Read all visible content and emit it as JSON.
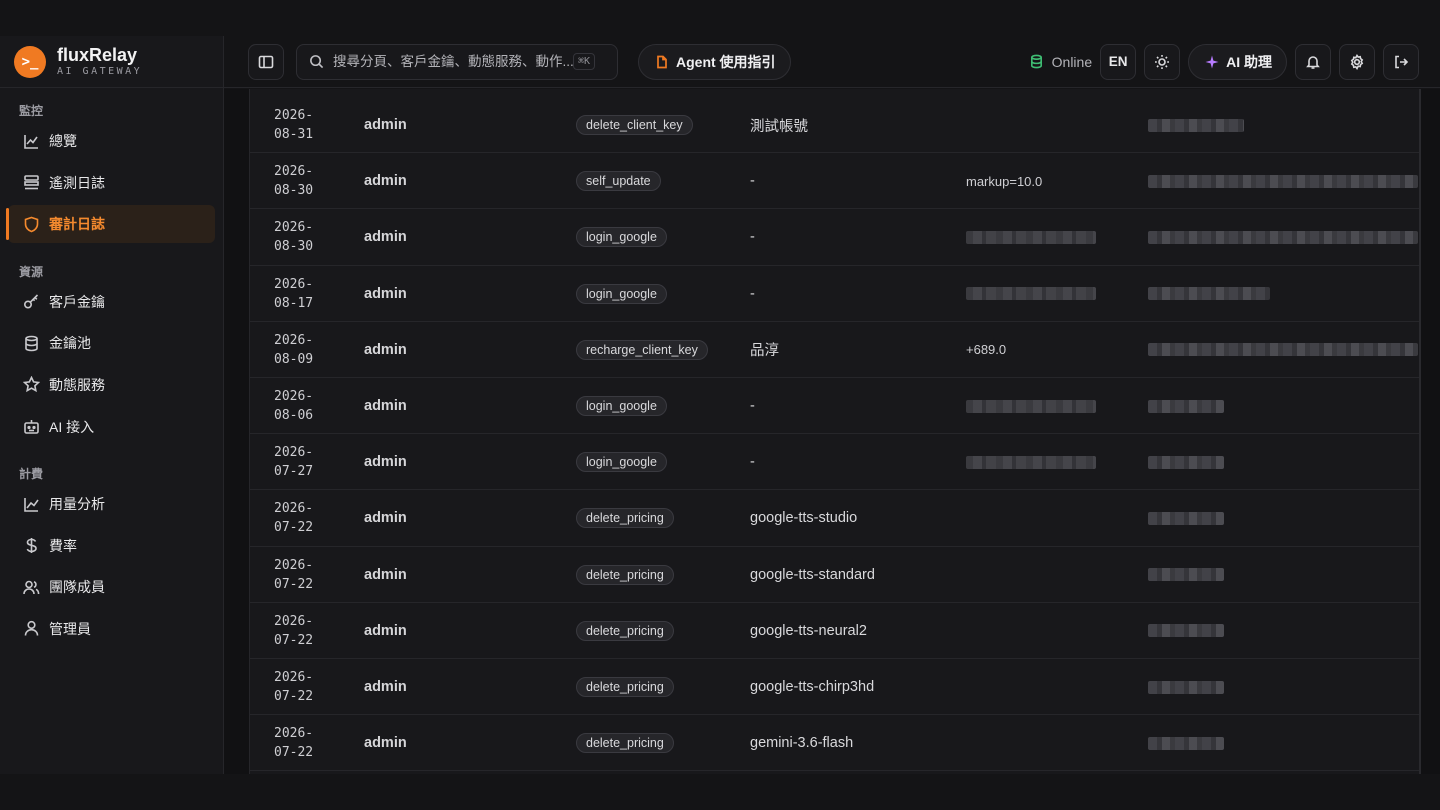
{
  "brand": {
    "name": "fluxRelay",
    "subtitle": "AI GATEWAY",
    "logo_glyph": ">_",
    "accent": "#f07a22"
  },
  "sidebar": {
    "sections": [
      {
        "label": "監控",
        "items": [
          {
            "label": "總覽",
            "icon": "line-chart-icon",
            "active": false
          },
          {
            "label": "遙測日誌",
            "icon": "log-list-icon",
            "active": false
          },
          {
            "label": "審計日誌",
            "icon": "shield-icon",
            "active": true
          }
        ]
      },
      {
        "label": "資源",
        "items": [
          {
            "label": "客戶金鑰",
            "icon": "key-icon",
            "active": false
          },
          {
            "label": "金鑰池",
            "icon": "database-icon",
            "active": false
          },
          {
            "label": "動態服務",
            "icon": "star-icon",
            "active": false
          },
          {
            "label": "AI 接入",
            "icon": "robot-icon",
            "active": false
          }
        ]
      },
      {
        "label": "計費",
        "items": [
          {
            "label": "用量分析",
            "icon": "trend-chart-icon",
            "active": false
          },
          {
            "label": "費率",
            "icon": "dollar-icon",
            "active": false
          },
          {
            "label": "團隊成員",
            "icon": "team-icon",
            "active": false
          },
          {
            "label": "管理員",
            "icon": "user-icon",
            "active": false
          }
        ]
      }
    ]
  },
  "header": {
    "search_placeholder": "搜尋分頁、客戶金鑰、動態服務、動作...",
    "search_shortcut": "⌘K",
    "agent_button": "Agent 使用指引",
    "status": "Online",
    "status_color": "#3fbf74",
    "lang": "EN",
    "ai_button": "AI 助理",
    "ai_color": "#b77cff"
  },
  "audit_rows": [
    {
      "date": "2026-\n08-31",
      "user": "admin",
      "action": "delete_client_key",
      "target": "測試帳號",
      "detail": "",
      "detail_redacted": false,
      "ip_width": 96
    },
    {
      "date": "2026-\n08-30",
      "user": "admin",
      "action": "self_update",
      "target": "-",
      "detail": "markup=10.0",
      "detail_redacted": false,
      "ip_width": 270
    },
    {
      "date": "2026-\n08-30",
      "user": "admin",
      "action": "login_google",
      "target": "-",
      "detail": "",
      "detail_redacted": true,
      "ip_width": 270
    },
    {
      "date": "2026-\n08-17",
      "user": "admin",
      "action": "login_google",
      "target": "-",
      "detail": "",
      "detail_redacted": true,
      "ip_width": 122
    },
    {
      "date": "2026-\n08-09",
      "user": "admin",
      "action": "recharge_client_key",
      "target": "品淳",
      "detail": "+689.0",
      "detail_redacted": false,
      "ip_width": 270
    },
    {
      "date": "2026-\n08-06",
      "user": "admin",
      "action": "login_google",
      "target": "-",
      "detail": "",
      "detail_redacted": true,
      "ip_width": 76
    },
    {
      "date": "2026-\n07-27",
      "user": "admin",
      "action": "login_google",
      "target": "-",
      "detail": "",
      "detail_redacted": true,
      "ip_width": 76
    },
    {
      "date": "2026-\n07-22",
      "user": "admin",
      "action": "delete_pricing",
      "target": "google-tts-studio",
      "detail": "",
      "detail_redacted": false,
      "ip_width": 76
    },
    {
      "date": "2026-\n07-22",
      "user": "admin",
      "action": "delete_pricing",
      "target": "google-tts-standard",
      "detail": "",
      "detail_redacted": false,
      "ip_width": 76
    },
    {
      "date": "2026-\n07-22",
      "user": "admin",
      "action": "delete_pricing",
      "target": "google-tts-neural2",
      "detail": "",
      "detail_redacted": false,
      "ip_width": 76
    },
    {
      "date": "2026-\n07-22",
      "user": "admin",
      "action": "delete_pricing",
      "target": "google-tts-chirp3hd",
      "detail": "",
      "detail_redacted": false,
      "ip_width": 76
    },
    {
      "date": "2026-\n07-22",
      "user": "admin",
      "action": "delete_pricing",
      "target": "gemini-3.6-flash",
      "detail": "",
      "detail_redacted": false,
      "ip_width": 76
    }
  ]
}
